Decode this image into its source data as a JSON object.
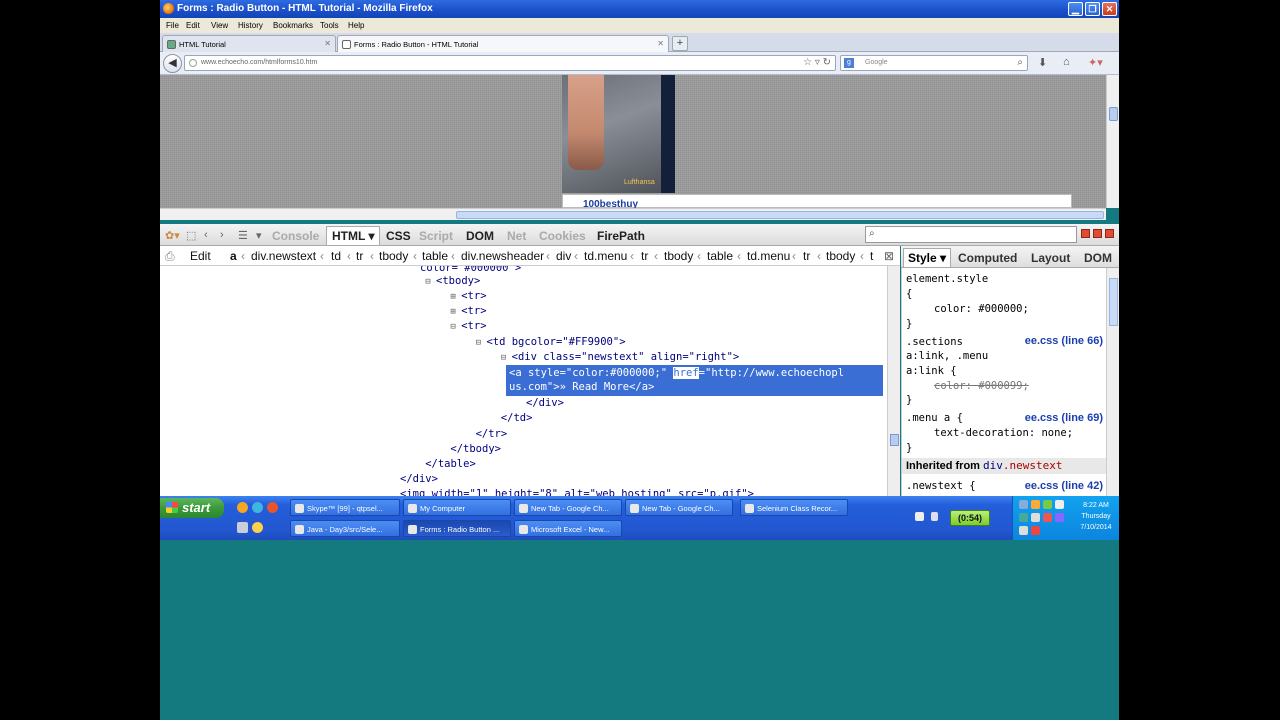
{
  "window": {
    "title": "Forms : Radio Button - HTML Tutorial - Mozilla Firefox",
    "controls": [
      "minimize",
      "maximize",
      "close"
    ]
  },
  "menu": [
    "File",
    "Edit",
    "View",
    "History",
    "Bookmarks",
    "Tools",
    "Help"
  ],
  "tabs": [
    {
      "label": "HTML Tutorial",
      "active": false
    },
    {
      "label": "Forms : Radio Button - HTML Tutorial",
      "active": true
    }
  ],
  "nav": {
    "url": "www.echoecho.com/htmlforms10.htm",
    "search_placeholder": "Google"
  },
  "page": {
    "ad_brand": "Lufthansa",
    "banner_text": "100besthuy"
  },
  "firebug": {
    "tabs": [
      {
        "label": "Console",
        "dim": true
      },
      {
        "label": "HTML ▾",
        "selected": true
      },
      {
        "label": "CSS"
      },
      {
        "label": "Script",
        "dim": true
      },
      {
        "label": "DOM"
      },
      {
        "label": "Net",
        "dim": true
      },
      {
        "label": "Cookies",
        "dim": true
      },
      {
        "label": "FirePath"
      }
    ],
    "breadcrumb": [
      "Edit",
      "a",
      "div.newstext",
      "td",
      "tr",
      "tbody",
      "table",
      "div.newsheader",
      "div",
      "td.menu",
      "tr",
      "tbody",
      "table",
      "td.menu",
      "tr",
      "tbody",
      "t"
    ],
    "side_tabs": [
      "Style ▾",
      "Computed",
      "Layout",
      "DOM"
    ],
    "tree": [
      {
        "indent": 33,
        "text": "<tbody>",
        "exp": "⊟"
      },
      {
        "indent": 37,
        "text": "<tr>",
        "exp": "⊞"
      },
      {
        "indent": 37,
        "text": "<tr>",
        "exp": "⊞"
      },
      {
        "indent": 37,
        "text": "<tr>",
        "exp": "⊟"
      },
      {
        "indent": 41,
        "text": "<td bgcolor=\"#FF9900\">",
        "exp": "⊟"
      },
      {
        "indent": 45,
        "text": "<div class=\"newstext\" align=\"right\">",
        "exp": "⊟"
      },
      {
        "indent": 49,
        "text": "</div>"
      },
      {
        "indent": 45,
        "text": "</td>"
      },
      {
        "indent": 41,
        "text": "</tr>"
      },
      {
        "indent": 37,
        "text": "</tbody>"
      },
      {
        "indent": 33,
        "text": "</table>"
      },
      {
        "indent": 29,
        "text": "</div>"
      },
      {
        "indent": 29,
        "text": "<img width=\"1\" height=\"8\" alt=\"web hosting\" src=\"p.gif\">"
      }
    ],
    "tree_partial_top": "color=\"#000000\">",
    "selected_line1_a": "<a style=\"color:#000000;\" ",
    "selected_line1_hl": "href",
    "selected_line1_b": "=\"http://www.echoechopl",
    "selected_line2": "us.com\">» Read More</a>",
    "styles": {
      "rule1_sel": "element.style",
      "rule1_open": "{",
      "rule1_prop": "color: #000000;",
      "rule1_close": "}",
      "rule2_sel_1": ".sections",
      "rule2_sel_2": "a:link, .menu",
      "rule2_sel_3": "a:link {",
      "rule2_src": "ee.css (line 66)",
      "rule2_prop_name": "color",
      "rule2_prop_val": ": #000099;",
      "rule2_close": "}",
      "rule3_sel": ".menu a {",
      "rule3_src": "ee.css (line 69)",
      "rule3_prop": "text-decoration: none;",
      "rule3_close": "}",
      "inherited_label": "Inherited from",
      "inherited_tag": "div",
      "inherited_cls": ".newstext",
      "rule4_sel": ".newstext {",
      "rule4_src": "ee.css (line 42)"
    }
  },
  "taskbar": {
    "start": "start",
    "buttons": [
      {
        "label": "Skype™ [99] - qtpsel...",
        "row": 0,
        "active": false
      },
      {
        "label": "My Computer",
        "row": 0,
        "active": false
      },
      {
        "label": "New Tab - Google Ch...",
        "row": 0,
        "active": false
      },
      {
        "label": "New Tab - Google Ch...",
        "row": 0,
        "active": false
      },
      {
        "label": "Selenium Class Recor...",
        "row": 0,
        "active": false
      },
      {
        "label": "Java - Day3/src/Sele...",
        "row": 1,
        "active": false
      },
      {
        "label": "Forms : Radio Button ...",
        "row": 1,
        "active": true
      },
      {
        "label": "Microsoft Excel - New...",
        "row": 1,
        "active": false
      }
    ],
    "timer": "(0:54)",
    "clock_time": "8:22 AM",
    "clock_day": "Thursday",
    "clock_date": "7/10/2014"
  }
}
